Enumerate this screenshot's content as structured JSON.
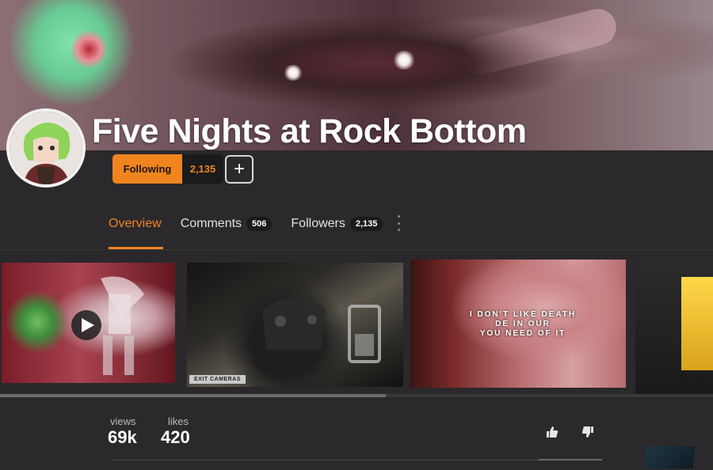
{
  "channel": {
    "title": "Five Nights at Rock Bottom"
  },
  "follow": {
    "following_label": "Following",
    "followers_count": "2,135",
    "add_label": "+"
  },
  "tabs": [
    {
      "label": "Overview"
    },
    {
      "label": "Comments",
      "badge": "506"
    },
    {
      "label": "Followers",
      "badge": "2,135"
    }
  ],
  "gallery": {
    "thumb2_tag": "EXIT CAMERAS",
    "thumb3_caption_line1": "I DON'T LIKE DEATH",
    "thumb3_caption_line2": "DE IN OUR",
    "thumb3_caption_line3": "YOU NEED OF IT"
  },
  "stats": {
    "views_label": "views",
    "views_value": "69k",
    "likes_label": "likes",
    "likes_value": "420"
  },
  "colors": {
    "accent": "#f0851f",
    "background": "#2b292c",
    "badge_bg": "#1b1a1c"
  },
  "icons": [
    "play-icon",
    "plus-icon",
    "more-vertical-icon",
    "thumbs-up-icon",
    "thumbs-down-icon"
  ]
}
